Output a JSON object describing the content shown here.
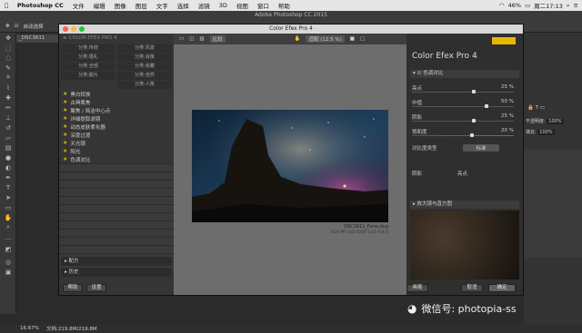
{
  "menubar": {
    "apple": "",
    "app": "Photoshop CC",
    "items": [
      "文件",
      "编辑",
      "图像",
      "图层",
      "文字",
      "选择",
      "滤镜",
      "3D",
      "视图",
      "窗口",
      "帮助"
    ],
    "battery": "46%",
    "time": "周二17:13"
  },
  "ps": {
    "title": "Adobe Photoshop CC 2015",
    "options_label": "自动选择",
    "doctab": "_DSC3611",
    "status_zoom": "16.67%",
    "status_doc": "文档:219.8M/219.8M",
    "right_opacity_label": "不透明度:",
    "right_opacity": "100%",
    "right_fill_label": "填充:",
    "right_fill": "100%"
  },
  "plugin": {
    "title": "Color Efex Pro 4",
    "left": {
      "header": "COLOR EFEX PRO 4",
      "categories": [
        "分类:传统",
        "分类:风景",
        "分类:婚礼",
        "分类:肖像",
        "分类:全部",
        "分类:收藏",
        "分类:胶片",
        "分类:自然",
        "分类:人像"
      ],
      "filters": [
        "黑白转换",
        "古典柔焦",
        "聚焦 / 简洁中心点",
        "详细提取滤镜",
        "动态皮肤柔化器",
        "深度过渡",
        "天光镜",
        "阳光",
        "色调对比"
      ],
      "recipes": "配方",
      "history": "历史"
    },
    "center": {
      "zoom": "适配 (12.5 %)",
      "compare": "比较",
      "file": "DSC3611_Pano.dng",
      "exif": "SEA MF ISO 5000 1/25 F/4.0"
    },
    "right": {
      "brand": "Color Efex Pro",
      "version": "4",
      "filter_name": "色调对比",
      "sliders": [
        {
          "label": "亮点",
          "value": "25 %"
        },
        {
          "label": "中值",
          "value": "50 %"
        },
        {
          "label": "阴影",
          "value": "25 %"
        },
        {
          "label": "饱和度",
          "value": "20 %"
        }
      ],
      "contrast_label": "对比度类型",
      "contrast_value": "标准",
      "shadow_label": "阴影",
      "highlight_label": "亮点",
      "loupe": "放大镜与直方图"
    },
    "buttons": {
      "help": "帮助",
      "settings": "设置",
      "brush": "画笔",
      "cancel": "取消",
      "ok": "确定"
    }
  },
  "watermark": "微信号: photopia-ss"
}
